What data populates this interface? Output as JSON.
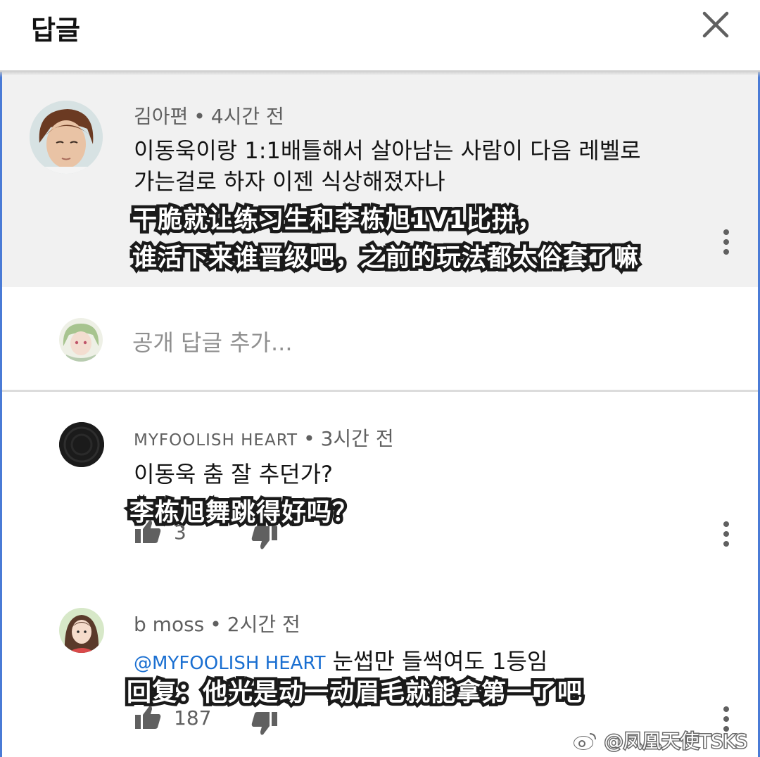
{
  "header": {
    "title": "답글"
  },
  "parent_comment": {
    "author": "김아편",
    "time": "4시간 전",
    "text_line1": "이동욱이랑 1:1배틀해서 살아남는 사람이 다음 레벨로",
    "text_line2": "가는걸로 하자 이젠 식상해졌자나",
    "subtitle_line1": "干脆就让练习生和李栋旭1V1比拼，",
    "subtitle_line2": "谁活下来谁晋级吧，之前的玩法都太俗套了嘛"
  },
  "reply_box": {
    "placeholder": "공개 답글 추가..."
  },
  "replies": [
    {
      "author": "MYFOOLISH HEART",
      "time": "3시간 전",
      "text": "이동욱 춤 잘 추던가?",
      "subtitle": "李栋旭舞跳得好吗？",
      "likes": "3"
    },
    {
      "author": "b moss",
      "time": "2시간 전",
      "mention": "@MYFOOLISH HEART",
      "text": "눈썹만 들썩여도 1등임",
      "subtitle": "回复：他光是动一动眉毛就能拿第一了吧",
      "likes": "187"
    }
  ],
  "separator": "•",
  "watermark": "@凤凰天使TSKS",
  "icons": [
    "close-icon",
    "thumbs-up-icon",
    "thumbs-down-icon",
    "more-vert-icon",
    "weibo-icon"
  ]
}
